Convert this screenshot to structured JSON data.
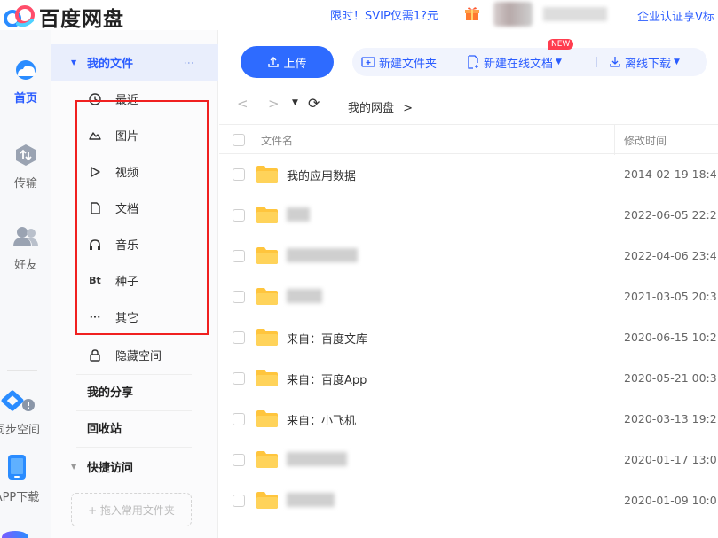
{
  "app": {
    "logo_text": "百度网盘",
    "promo": "限时！SVIP仅需1?元",
    "enterprise": "企业认证享V标"
  },
  "rail": {
    "items": [
      {
        "label": "首页",
        "icon": "cloud-icon"
      },
      {
        "label": "传输",
        "icon": "transfer-icon"
      },
      {
        "label": "好友",
        "icon": "friends-icon"
      },
      {
        "label": "同步空间",
        "icon": "sync-space-icon"
      },
      {
        "label": "APP下载",
        "icon": "phone-icon"
      }
    ]
  },
  "sidebar": {
    "my_files": "我的文件",
    "categories": [
      {
        "label": "最近",
        "icon": "clock-icon"
      },
      {
        "label": "图片",
        "icon": "image-icon"
      },
      {
        "label": "视频",
        "icon": "play-icon"
      },
      {
        "label": "文档",
        "icon": "document-icon"
      },
      {
        "label": "音乐",
        "icon": "headphones-icon"
      },
      {
        "label": "种子",
        "icon": "bt-icon",
        "glyph": "Bt"
      },
      {
        "label": "其它",
        "icon": "more-icon",
        "glyph": "···"
      },
      {
        "label": "隐藏空间",
        "icon": "lock-icon"
      }
    ],
    "my_share": "我的分享",
    "recycle_bin": "回收站",
    "quick_access": "快捷访问",
    "dropzone": "+ 拖入常用文件夹"
  },
  "toolbar": {
    "upload": "上传",
    "new_folder": "新建文件夹",
    "new_online_doc": "新建在线文档",
    "new_badge": "NEW",
    "offline_download": "离线下载"
  },
  "breadcrumb": {
    "path": "我的网盘",
    "separator": ">"
  },
  "table": {
    "col_name": "文件名",
    "col_modified": "修改时间",
    "rows": [
      {
        "name": "我的应用数据",
        "date": "2014-02-19 18:4",
        "blurred": false
      },
      {
        "name": "",
        "date": "2022-06-05 22:2",
        "blurred": true
      },
      {
        "name": "",
        "date": "2022-04-06 23:4",
        "blurred": true
      },
      {
        "name": "",
        "date": "2021-03-05 20:3",
        "blurred": true
      },
      {
        "name": "来自：百度文库",
        "date": "2020-06-15 10:2",
        "blurred": false
      },
      {
        "name": "来自：百度App",
        "date": "2020-05-21 00:3",
        "blurred": false
      },
      {
        "name": "来自：小飞机",
        "date": "2020-03-13 19:2",
        "blurred": false
      },
      {
        "name": "",
        "date": "2020-01-17 13:0",
        "blurred": true
      },
      {
        "name": "",
        "date": "2020-01-09 10:0",
        "blurred": true
      }
    ]
  },
  "colors": {
    "accent": "#2e6bff",
    "folder": "#ffc53d",
    "highlight_box": "#f02020"
  }
}
